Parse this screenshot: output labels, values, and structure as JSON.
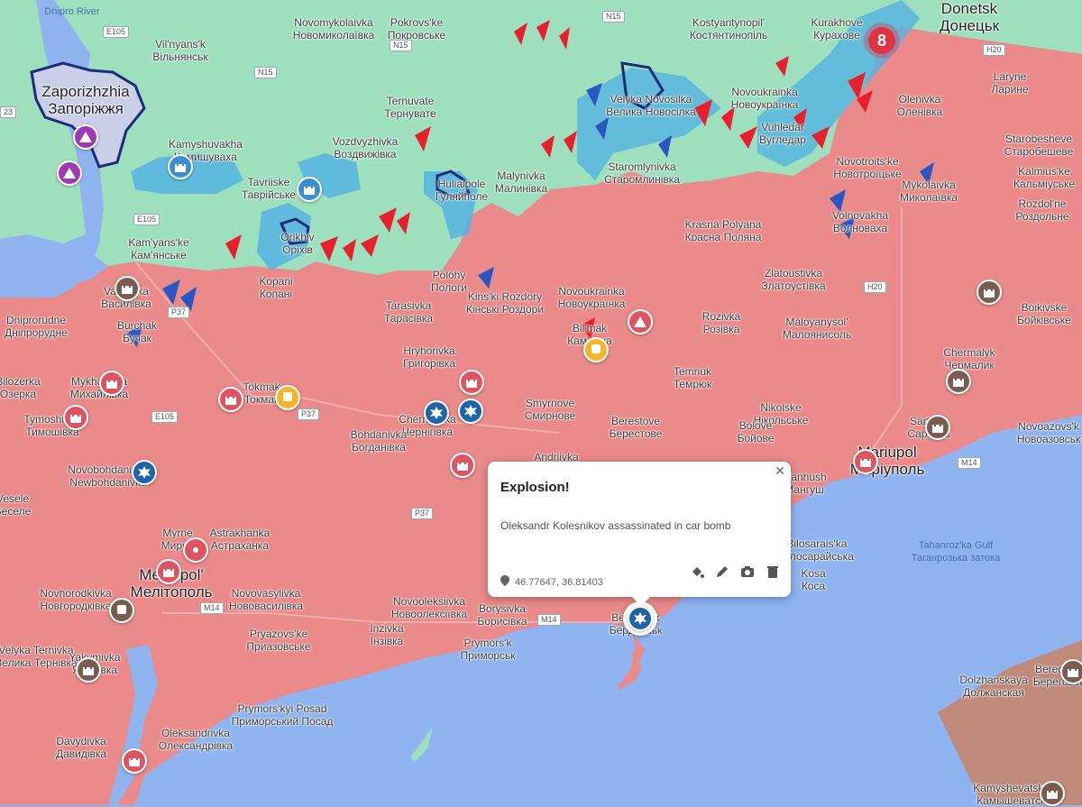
{
  "map": {
    "colors": {
      "water": "#8fb4f0",
      "ukraine": "#9ee0be",
      "occupied": "#ea8a8a",
      "contested": "#54b3e0",
      "russia": "#c08a7a"
    },
    "cluster_count": "8",
    "settlements": [
      {
        "id": "zaporizhzhia",
        "en": "Zaporizhzhia",
        "uk": "Запоріжжя",
        "major": true
      },
      {
        "id": "novomykolaivka",
        "en": "Novomykolaivka",
        "uk": "Новомиколаївка"
      },
      {
        "id": "vilnyansk",
        "en": "Vil'nyans'k",
        "uk": "Вільнянськ"
      },
      {
        "id": "pokrovske",
        "en": "Pokrovs'ke",
        "uk": "Покровське"
      },
      {
        "id": "kostiantynopil",
        "en": "Kostyantynopil'",
        "uk": "Костянтинопіль"
      },
      {
        "id": "kurakhove",
        "en": "Kurakhove",
        "uk": "Курахове"
      },
      {
        "id": "donetsk",
        "en": "Donetsk",
        "uk": "Донецьк",
        "major": true
      },
      {
        "id": "laryne",
        "en": "Laryne",
        "uk": "Ларине"
      },
      {
        "id": "ternuvate",
        "en": "Ternuvate",
        "uk": "Тернувате"
      },
      {
        "id": "velyka-novosilka",
        "en": "Velyka Novosilka",
        "uk": "Велика Новосілка"
      },
      {
        "id": "novoukrainka-n",
        "en": "Novoukrainka",
        "uk": "Новоукраїнка"
      },
      {
        "id": "olenivka",
        "en": "Olenivka",
        "uk": "Оленівка"
      },
      {
        "id": "vozdvyzhivka",
        "en": "Vozdvyzhivka",
        "uk": "Воздвижівка"
      },
      {
        "id": "vuhledar",
        "en": "Vuhledar",
        "uk": "Вугледар"
      },
      {
        "id": "starobesheve",
        "en": "Starobesheve",
        "uk": "Старобешеве"
      },
      {
        "id": "kamyshuvakha",
        "en": "Kamyshuvakha",
        "uk": "Камишуваха"
      },
      {
        "id": "tavriiske",
        "en": "Tavriiske",
        "uk": "Таврійське"
      },
      {
        "id": "huliaipole",
        "en": "Huliaipole",
        "uk": "Гуляйполе"
      },
      {
        "id": "malynivka",
        "en": "Malynivka",
        "uk": "Малинівка"
      },
      {
        "id": "staromlynivka",
        "en": "Staromlynivka",
        "uk": "Старомлинівка"
      },
      {
        "id": "novotroitske",
        "en": "Novotroits'ke",
        "uk": "Новотроїцьке"
      },
      {
        "id": "kalmiuske",
        "en": "Kalmius'ke",
        "uk": "Кальміуське"
      },
      {
        "id": "mykolaivka-e",
        "en": "Mykolaivka",
        "uk": "Миколаївка"
      },
      {
        "id": "rozdolne",
        "en": "Rozdol'ne",
        "uk": "Роздольне"
      },
      {
        "id": "kamianske",
        "en": "Kam'yans'ke",
        "uk": "Кам'янське"
      },
      {
        "id": "orikhiv",
        "en": "Orikhiv",
        "uk": "Оріхів"
      },
      {
        "id": "volnovakha",
        "en": "Volnovakha",
        "uk": "Волноваха"
      },
      {
        "id": "krasna-polyana",
        "en": "Krasna Polyana",
        "uk": "Красна Поляна"
      },
      {
        "id": "vasylivka",
        "en": "Vasylivka",
        "uk": "Василівка"
      },
      {
        "id": "kopani",
        "en": "Kopani",
        "uk": "Копані"
      },
      {
        "id": "polohy",
        "en": "Polohy",
        "uk": "Пологи"
      },
      {
        "id": "novoukrainka-s",
        "en": "Novoukrainka",
        "uk": "Новоукраїнка"
      },
      {
        "id": "zlatoustivka",
        "en": "Zlatoustivka",
        "uk": "Златоустівка"
      },
      {
        "id": "dniprorudne",
        "en": "Dniprorudne",
        "uk": "Дніпрорудне"
      },
      {
        "id": "tarasivka",
        "en": "Tarasivka",
        "uk": "Тарасівка"
      },
      {
        "id": "kinski-rozdory",
        "en": "Kins'ki Rozdory",
        "uk": "Кінські Роздори"
      },
      {
        "id": "boikivske",
        "en": "Boikivske",
        "uk": "Бойківське"
      },
      {
        "id": "burchak",
        "en": "Burchak",
        "uk": "Бучак"
      },
      {
        "id": "bilmak",
        "en": "Bil'mak",
        "uk": "Кам'янка"
      },
      {
        "id": "rozivka",
        "en": "Rozivka",
        "uk": "Розівка"
      },
      {
        "id": "maloyanysol",
        "en": "Maloyanysol'",
        "uk": "Малоянисоль"
      },
      {
        "id": "bilozerka",
        "en": "Bilozerka",
        "uk": "Озерка"
      },
      {
        "id": "mykhailivka",
        "en": "Mykhailivka",
        "uk": "Михайлівка"
      },
      {
        "id": "hryhorivka",
        "en": "Hryhorivka",
        "uk": "Григорівка"
      },
      {
        "id": "chermalyk",
        "en": "Chermalyk",
        "uk": "Чермалик"
      },
      {
        "id": "tokmak",
        "en": "Tokmak",
        "uk": "Токмак"
      },
      {
        "id": "temriuk",
        "en": "Temriuk",
        "uk": "Темрюк"
      },
      {
        "id": "tymoshivka",
        "en": "Tymoshivka",
        "uk": "Тимошівка"
      },
      {
        "id": "chernihivka",
        "en": "Chernihivka",
        "uk": "Чернігівка"
      },
      {
        "id": "smyrnove",
        "en": "Smyrnove",
        "uk": "Смирнове"
      },
      {
        "id": "nikolske",
        "en": "Nikolske",
        "uk": "Нікольське"
      },
      {
        "id": "boiove",
        "en": "Boiove",
        "uk": "Бойове"
      },
      {
        "id": "sartana",
        "en": "Sartana",
        "uk": "Сартана"
      },
      {
        "id": "novoazovsk",
        "en": "Novoazovs'k",
        "uk": "Новоазовськ"
      },
      {
        "id": "novobohdanivka",
        "en": "Novobohdanivka",
        "uk": "Newbohdanivka"
      },
      {
        "id": "bohdanivka",
        "en": "Bohdanivka",
        "uk": "Богданівка"
      },
      {
        "id": "berestove",
        "en": "Berestove",
        "uk": "Берестове"
      },
      {
        "id": "andriivka",
        "en": "Andriivka",
        "uk": ""
      },
      {
        "id": "mariupol",
        "en": "Mariupol",
        "uk": "Маріуполь",
        "major": true
      },
      {
        "id": "mangush",
        "en": "Manhush",
        "uk": "Мангуш"
      },
      {
        "id": "vesele",
        "en": "Vesele",
        "uk": "Веселе"
      },
      {
        "id": "myrne",
        "en": "Myrne",
        "uk": "Мирне"
      },
      {
        "id": "astrakhanka",
        "en": "Astrakhanka",
        "uk": "Астраханка"
      },
      {
        "id": "melitopol",
        "en": "Melitopol'",
        "uk": "Мелітополь",
        "major": true
      },
      {
        "id": "novhorodkivka",
        "en": "Novhorodkivka",
        "uk": "Новгородківка"
      },
      {
        "id": "novovasylivka",
        "en": "Novovasylivka",
        "uk": "Нововасилівка"
      },
      {
        "id": "novooleksiivka",
        "en": "Novooleksiivka",
        "uk": "Новоолексіївка"
      },
      {
        "id": "borysivka",
        "en": "Borysivka",
        "uk": "Борисівка"
      },
      {
        "id": "bilosaraiska",
        "en": "Bilosarais'ka",
        "uk": "Білосарайська"
      },
      {
        "id": "kosa",
        "en": "Kosa",
        "uk": "Коса"
      },
      {
        "id": "pryazovske",
        "en": "Pryazovs'ke",
        "uk": "Приазовське"
      },
      {
        "id": "inzivka",
        "en": "Inzivka",
        "uk": "Інзівка"
      },
      {
        "id": "prymorsk",
        "en": "Prymors'k",
        "uk": "Приморськ"
      },
      {
        "id": "berdiansk",
        "en": "Berdiansk",
        "uk": "Бердянськ"
      },
      {
        "id": "velyka-ternivka",
        "en": "Velyka Ternivka",
        "uk": "Велика Тернівка"
      },
      {
        "id": "yakymivka",
        "en": "Yakymivka",
        "uk": "Якимівка"
      },
      {
        "id": "prymorskyi-posad",
        "en": "Prymors'kyi Posad",
        "uk": "Приморський Посад"
      },
      {
        "id": "oleksandrivka",
        "en": "Oleksandrivka",
        "uk": "Олександрівка"
      },
      {
        "id": "davydivka",
        "en": "Davydivka",
        "uk": "Давидівка"
      },
      {
        "id": "dolzhanskaya",
        "en": "Dolzhanskaya",
        "uk": "Должанская"
      },
      {
        "id": "beregovoi",
        "en": "Beregovoi",
        "uk": "Береговой"
      },
      {
        "id": "kamyshevatskaya",
        "en": "Kamyshevatskaya",
        "uk": "Камышеватская"
      }
    ],
    "water_labels": [
      {
        "id": "gulf",
        "lines": [
          "Tahanroz'ka Gulf",
          "Таганрозька затока"
        ]
      },
      {
        "id": "river",
        "lines": [
          "Dnipro River"
        ]
      }
    ],
    "roads": [
      "E105",
      "N15",
      "N15",
      "N15",
      "N20",
      "H20",
      "P37",
      "P37",
      "E105",
      "M14",
      "M14",
      "P37",
      "E105",
      "M14",
      "H20",
      "23"
    ]
  },
  "popup": {
    "title": "Explosion!",
    "description": "Oleksandr Kolesnikov assassinated in car bomb",
    "coordinates": "46.77647, 36.81403",
    "close_icon": "close-icon",
    "actions": [
      "style-icon",
      "edit-icon",
      "camera-icon",
      "delete-icon"
    ]
  }
}
